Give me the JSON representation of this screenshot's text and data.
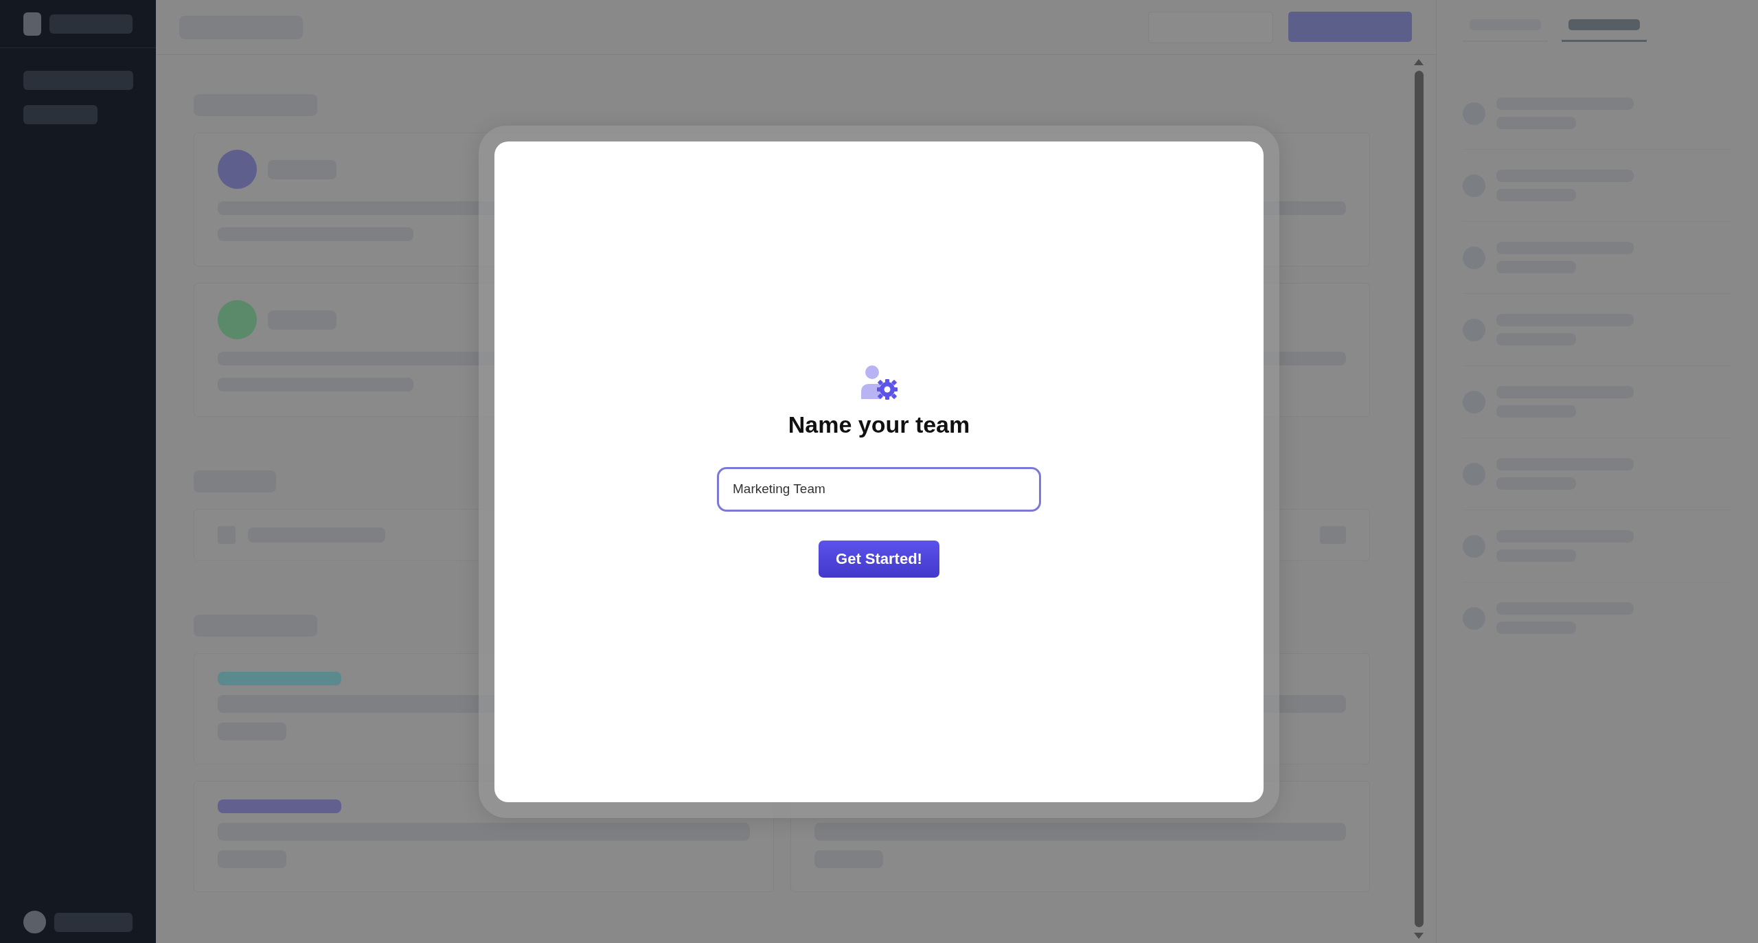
{
  "dialog": {
    "title": "Name your team",
    "team_name_field": {
      "value": "Marketing Team"
    },
    "submit_button": {
      "label": "Get Started!"
    }
  }
}
